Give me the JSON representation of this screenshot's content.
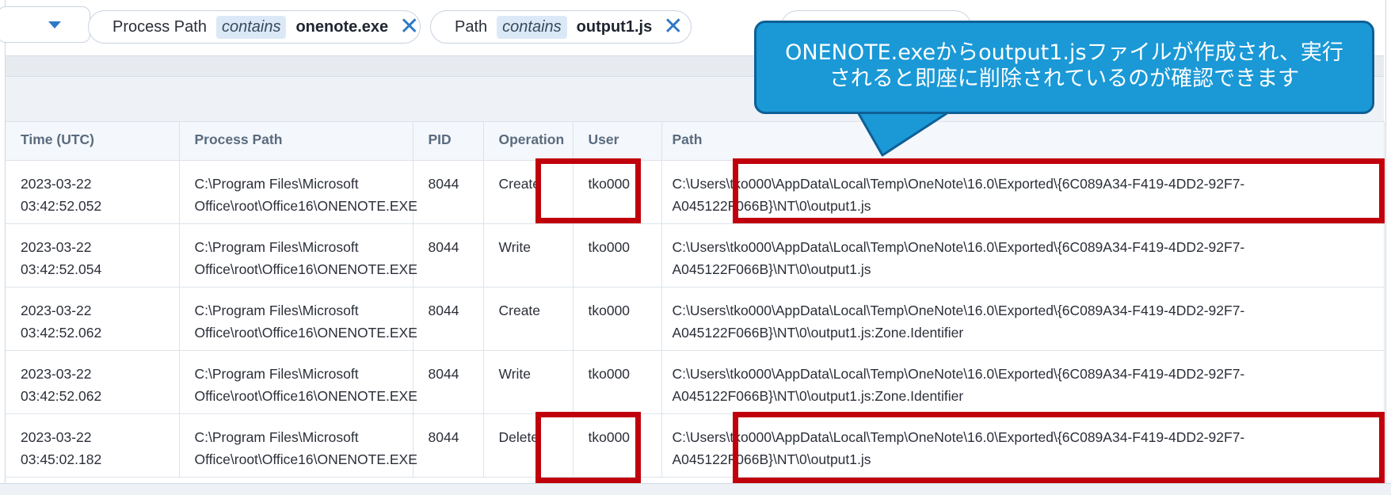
{
  "filters": {
    "chips": [
      {
        "field": "Process Path",
        "operator": "contains",
        "value": "onenote.exe",
        "remove_icon": "close-icon"
      },
      {
        "field": "Path",
        "operator": "contains",
        "value": "output1.js",
        "remove_icon": "close-icon"
      }
    ]
  },
  "callout": {
    "line1": "ONENOTE.exeからoutput1.jsファイルが作成され、実行",
    "line2": "されると即座に削除されているのが確認できます"
  },
  "table": {
    "columns": [
      "Time (UTC)",
      "Process Path",
      "PID",
      "Operation",
      "User",
      "Path"
    ],
    "rows": [
      {
        "time": "2023-03-22 03:42:52.052",
        "proc1": "C:\\Program Files\\Microsoft",
        "proc2": "Office\\root\\Office16\\ONENOTE.EXE",
        "pid": "8044",
        "op": "Create",
        "user": "tko000",
        "path1": "C:\\Users\\tko000\\AppData\\Local\\Temp\\OneNote\\16.0\\Exported\\{6C089A34-F419-4DD2-92F7-",
        "path2": "A045122F066B}\\NT\\0\\output1.js"
      },
      {
        "time": "2023-03-22 03:42:52.054",
        "proc1": "C:\\Program Files\\Microsoft",
        "proc2": "Office\\root\\Office16\\ONENOTE.EXE",
        "pid": "8044",
        "op": "Write",
        "user": "tko000",
        "path1": "C:\\Users\\tko000\\AppData\\Local\\Temp\\OneNote\\16.0\\Exported\\{6C089A34-F419-4DD2-92F7-",
        "path2": "A045122F066B}\\NT\\0\\output1.js"
      },
      {
        "time": "2023-03-22 03:42:52.062",
        "proc1": "C:\\Program Files\\Microsoft",
        "proc2": "Office\\root\\Office16\\ONENOTE.EXE",
        "pid": "8044",
        "op": "Create",
        "user": "tko000",
        "path1": "C:\\Users\\tko000\\AppData\\Local\\Temp\\OneNote\\16.0\\Exported\\{6C089A34-F419-4DD2-92F7-",
        "path2": "A045122F066B}\\NT\\0\\output1.js:Zone.Identifier"
      },
      {
        "time": "2023-03-22 03:42:52.062",
        "proc1": "C:\\Program Files\\Microsoft",
        "proc2": "Office\\root\\Office16\\ONENOTE.EXE",
        "pid": "8044",
        "op": "Write",
        "user": "tko000",
        "path1": "C:\\Users\\tko000\\AppData\\Local\\Temp\\OneNote\\16.0\\Exported\\{6C089A34-F419-4DD2-92F7-",
        "path2": "A045122F066B}\\NT\\0\\output1.js:Zone.Identifier"
      },
      {
        "time": "2023-03-22 03:45:02.182",
        "proc1": "C:\\Program Files\\Microsoft",
        "proc2": "Office\\root\\Office16\\ONENOTE.EXE",
        "pid": "8044",
        "op": "Delete",
        "user": "tko000",
        "path1": "C:\\Users\\tko000\\AppData\\Local\\Temp\\OneNote\\16.0\\Exported\\{6C089A34-F419-4DD2-92F7-",
        "path2": "A045122F066B}\\NT\\0\\output1.js"
      }
    ]
  },
  "colors": {
    "highlight": "#c0000b",
    "callout_fill": "#1a99d6",
    "callout_border": "#0e5f96",
    "accent": "#2f78c4"
  }
}
